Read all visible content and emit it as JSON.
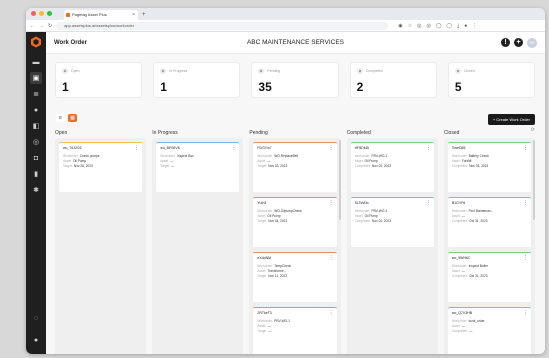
{
  "browser": {
    "tab_title": "Pagetag Asset Plus",
    "tab_close": "×",
    "new_tab": "+",
    "url": "app.assetsplus.ai/assetsplus/workorder",
    "dot_colors": [
      "#ff5f57",
      "#febc2e",
      "#28c840"
    ]
  },
  "sidebar": {
    "icons": [
      "inbox-icon",
      "dashboard-icon",
      "list-icon",
      "circle-icon",
      "chat-icon",
      "search-icon",
      "lock-icon",
      "chart-icon",
      "settings-icon"
    ],
    "bottom_icons": [
      "help-icon",
      "info-icon"
    ]
  },
  "header": {
    "title": "Work Order",
    "center": "ABC MAINTENANCE SERVICES",
    "notifications_glyph": "!",
    "add_glyph": "+",
    "avatar_initials": "SK"
  },
  "stats": [
    {
      "label": "Open",
      "value": "1"
    },
    {
      "label": "In Progress",
      "value": "1"
    },
    {
      "label": "Pending",
      "value": "35"
    },
    {
      "label": "Completed",
      "value": "2"
    },
    {
      "label": "Closed",
      "value": "5"
    }
  ],
  "toolbar": {
    "create_label": "+ Create Work Order",
    "refresh_glyph": "⟳"
  },
  "columns": [
    {
      "title": "Open",
      "status": "open",
      "cards": [
        {
          "id": "wo_76J2C6",
          "rows": [
            [
              "Workorder",
              "Check pumps"
            ],
            [
              "Asset",
              "Oil Pump"
            ],
            [
              "Target",
              "Nov 28, 2023"
            ]
          ]
        }
      ]
    },
    {
      "title": "In Progress",
      "status": "progress",
      "cards": [
        {
          "id": "wo_BFS6V6",
          "rows": [
            [
              "Workorder",
              "Inspect Box"
            ],
            [
              "Asset",
              "—"
            ],
            [
              "Target",
              "—"
            ]
          ]
        }
      ]
    },
    {
      "title": "Pending",
      "status": "pending",
      "cards": [
        {
          "id": "FDGYw7",
          "rows": [
            [
              "Workorder",
              "WO-ReplaceBelt"
            ],
            [
              "Asset",
              "—"
            ],
            [
              "Target",
              "Nov 03, 2023"
            ]
          ]
        },
        {
          "id": "YuIn3",
          "rows": [
            [
              "Workorder",
              "WO-OilpumpCheck"
            ],
            [
              "Asset",
              "Oil Pump"
            ],
            [
              "Target",
              "Nov 04, 2023"
            ]
          ]
        },
        {
          "id": "eXdoNM",
          "rows": [
            [
              "Workorder",
              "TempCheck"
            ],
            [
              "Asset",
              "Transforme..."
            ],
            [
              "Target",
              "Nov 11, 2023"
            ]
          ]
        },
        {
          "id": "2RTkeT3",
          "rows": [
            [
              "Workorder",
              "PRV-WO-1"
            ],
            [
              "Asset",
              "—"
            ],
            [
              "Target",
              "—"
            ]
          ]
        }
      ]
    },
    {
      "title": "Completed",
      "status": "completed",
      "cards": [
        {
          "id": "HF8DMA",
          "rows": [
            [
              "Workorder",
              "PRV-WO-1"
            ],
            [
              "Asset",
              "Oil Pump"
            ],
            [
              "Completed",
              "Nov 02, 2023"
            ]
          ]
        },
        {
          "id": "SLTsM3c",
          "rows": [
            [
              "Workorder",
              "PRV-WO-1"
            ],
            [
              "Asset",
              "Oil Pump"
            ],
            [
              "Completed",
              "Nov 02, 2023"
            ]
          ]
        }
      ]
    },
    {
      "title": "Closed",
      "status": "closed",
      "cards": [
        {
          "id": "TcseD85",
          "rows": [
            [
              "Workorder",
              "Battery Check"
            ],
            [
              "Asset",
              "Forklift"
            ],
            [
              "Completed",
              "Nov 03, 2023"
            ]
          ]
        },
        {
          "id": "B1GYF6",
          "rows": [
            [
              "Workorder",
              "Find Maintenan..."
            ],
            [
              "Asset",
              "—"
            ],
            [
              "Completed",
              "Oct 31, 2023"
            ]
          ]
        },
        {
          "id": "wo_9WH6C",
          "rows": [
            [
              "Workorder",
              "Inspect Boiler"
            ],
            [
              "Asset",
              "—"
            ],
            [
              "Completed",
              "Oct 31, 2023"
            ]
          ]
        },
        {
          "id": "wo_Q7V3HB",
          "rows": [
            [
              "Workorder",
              "work_order"
            ],
            [
              "Asset",
              "—"
            ],
            [
              "Completed",
              "—"
            ]
          ]
        }
      ]
    }
  ],
  "colors": {
    "accent": "#f26b1d",
    "sidebar": "#1f1f1f",
    "open": "#f0c24b",
    "progress": "#7fb0e8",
    "pending": "#ef8a6a",
    "completed": "#7dcb86"
  }
}
